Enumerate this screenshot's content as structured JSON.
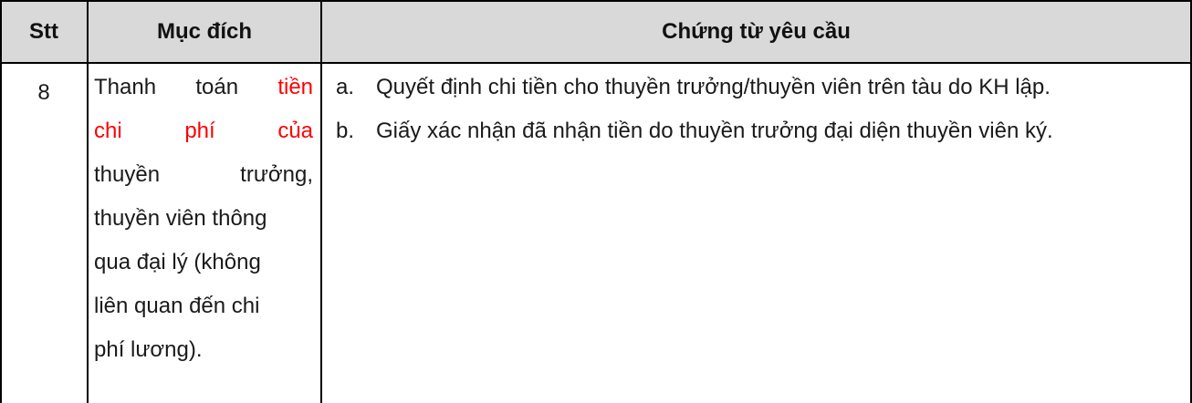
{
  "table": {
    "headers": {
      "stt": "Stt",
      "purpose": "Mục đích",
      "documents": "Chứng từ yêu cầu"
    },
    "row": {
      "stt": "8",
      "purpose": {
        "l1_a": "Thanh",
        "l1_b": "toán",
        "l1_c": "tiền",
        "l2_a": "chi",
        "l2_b": "phí",
        "l2_c": "của",
        "l3_a": "thuyền",
        "l3_b": "trưởng,",
        "l4": "thuyền viên thông",
        "l5": "qua đại lý (không",
        "l6": "liên quan đến chi",
        "l7": "phí lương)."
      },
      "requirements": [
        {
          "marker": "a.",
          "text": "Quyết định chi tiền cho thuyền trưởng/thuyền viên trên tàu do KH lập."
        },
        {
          "marker": "b.",
          "text": "Giấy xác nhận đã nhận tiền do thuyền trưởng đại diện thuyền viên ký."
        }
      ]
    },
    "colors": {
      "header_bg": "#d9d9d9",
      "highlight": "#ff0000",
      "border": "#000000"
    }
  }
}
